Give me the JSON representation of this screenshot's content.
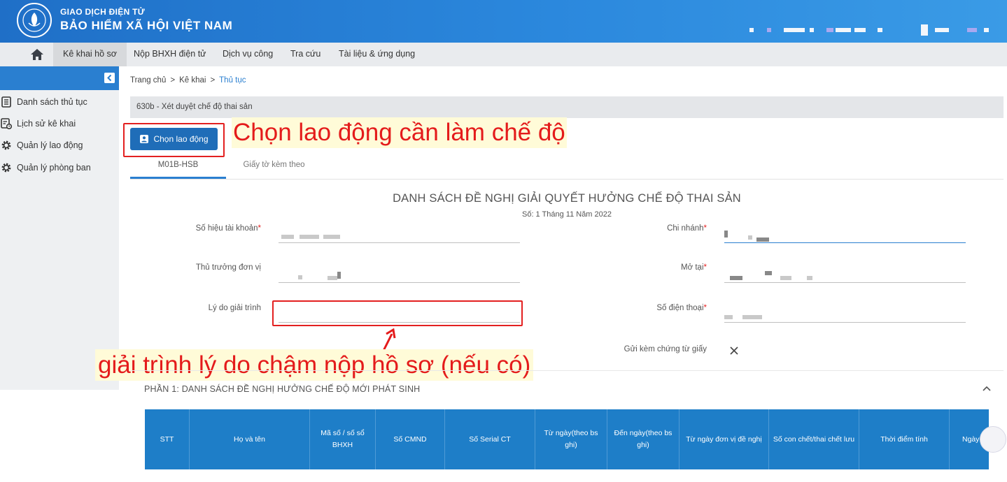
{
  "header": {
    "brand_line1": "GIAO DỊCH ĐIỆN TỬ",
    "brand_line2": "BẢO HIỂM XÃ HỘI VIỆT NAM",
    "logo_icon": "vss-logo-icon"
  },
  "menu": {
    "home_icon": "home-icon",
    "items": [
      {
        "label": "Kê khai hồ sơ",
        "active": true
      },
      {
        "label": "Nộp BHXH điện tử",
        "active": false
      },
      {
        "label": "Dịch vụ công",
        "active": false
      },
      {
        "label": "Tra cứu",
        "active": false
      },
      {
        "label": "Tài liệu & ứng dụng",
        "active": false
      }
    ]
  },
  "sidebar": {
    "collapse_icon": "collapse-left-icon",
    "items": [
      {
        "label": "Danh sách thủ tục",
        "icon": "list-icon"
      },
      {
        "label": "Lịch sử kê khai",
        "icon": "history-icon"
      },
      {
        "label": "Quản lý lao động",
        "icon": "gear-icon"
      },
      {
        "label": "Quản lý phòng ban",
        "icon": "gear-icon"
      }
    ]
  },
  "breadcrumb": {
    "items": [
      "Trang chủ",
      "Kê khai",
      "Thủ tục"
    ],
    "separator": ">"
  },
  "procedure_title": "630b - Xét duyệt chế độ thai sản",
  "choose_worker_button": "Chọn lao động",
  "annotation_top": "Chọn lao động cần làm chế độ",
  "annotation_bottom": "giải trình lý do chậm nộp hồ sơ (nếu có)",
  "tabs": [
    {
      "label": "M01B-HSB",
      "active": true
    },
    {
      "label": "Giấy tờ kèm theo",
      "active": false
    }
  ],
  "form": {
    "title": "DANH SÁCH ĐỀ NGHỊ GIẢI QUYẾT HƯỞNG CHẾ ĐỘ THAI SẢN",
    "subtitle": "Số: 1 Tháng 11 Năm 2022",
    "fields": {
      "account_number": {
        "label": "Số hiệu tài khoản",
        "required": "*"
      },
      "branch": {
        "label": "Chi nhánh",
        "required": "*"
      },
      "unit_head": {
        "label": "Thủ trưởng đơn vị"
      },
      "opened_at": {
        "label": "Mở tại",
        "required": "*"
      },
      "explanation": {
        "label": "Lý do giải trình",
        "value": ""
      },
      "phone": {
        "label": "Số điện thoại",
        "required": "*"
      },
      "attach_paper": {
        "label": "Gửi kèm chứng từ giấy"
      }
    }
  },
  "part1": {
    "title": "PHẦN 1: DANH SÁCH ĐỀ NGHỊ HƯỞNG CHẾ ĐỘ MỚI PHÁT SINH",
    "columns": [
      "STT",
      "Họ và tên",
      "Mã số / số sổ BHXH",
      "Số CMND",
      "Số Serial CT",
      "Từ ngày(theo bs ghi)",
      "Đến ngày(theo bs ghi)",
      "Từ ngày đơn vị đề nghị",
      "Số con chết/thai chết lưu",
      "Thời điểm tính",
      "Ngày"
    ]
  },
  "colors": {
    "header_blue": "#2a7fd0",
    "button_blue": "#1f6db8",
    "table_head": "#1e7ec8",
    "annotation_red": "#e41b1b",
    "annotation_bg": "#fffbd8"
  }
}
